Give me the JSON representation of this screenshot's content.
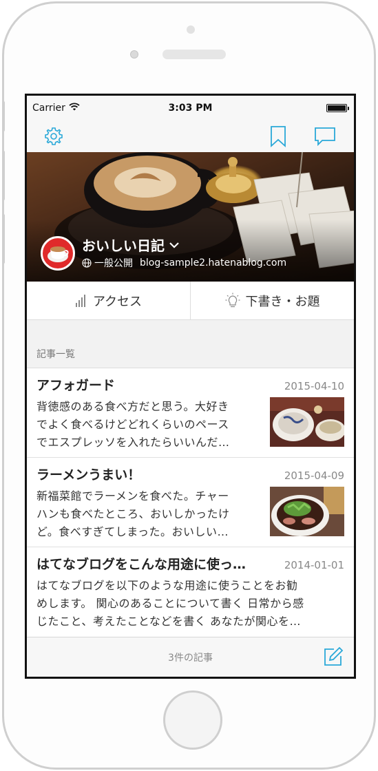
{
  "status_bar": {
    "carrier": "Carrier",
    "time": "3:03 PM"
  },
  "nav": {
    "settings_icon": "gear-icon",
    "bookmark_icon": "bookmark-icon",
    "comment_icon": "speech-bubble-icon",
    "accent": "#29a8d8"
  },
  "blog": {
    "title": "おいしい日記",
    "visibility": "一般公開",
    "domain": "blog-sample2.hatenablog.com"
  },
  "segments": {
    "access": "アクセス",
    "drafts": "下書き・お題"
  },
  "section_title": "記事一覧",
  "articles": [
    {
      "title": "アフォガード",
      "date": "2015-04-10",
      "lines": [
        "背徳感のある食べ方だと思う。大好き",
        "でよく食べるけどどれくらいのペース",
        "でエスプレッソを入れたらいいんだ…"
      ]
    },
    {
      "title": "ラーメンうまい！",
      "date": "2015-04-09",
      "lines": [
        "新福菜館でラーメンを食べた。チャー",
        "ハンも食べたところ、おいしかったけ",
        "ど。食べすぎてしまった。おいしい…"
      ]
    },
    {
      "title": "はてなブログをこんな用途に使っ…",
      "date": "2014-01-01",
      "lines": [
        "はてなブログを以下のような用途に使うことをお勧",
        "めします。 関心のあることについて書く 日常から感",
        "じたこと、考えたことなどを書く あなたが関心を…"
      ]
    }
  ],
  "footer": {
    "count": "3件の記事"
  }
}
